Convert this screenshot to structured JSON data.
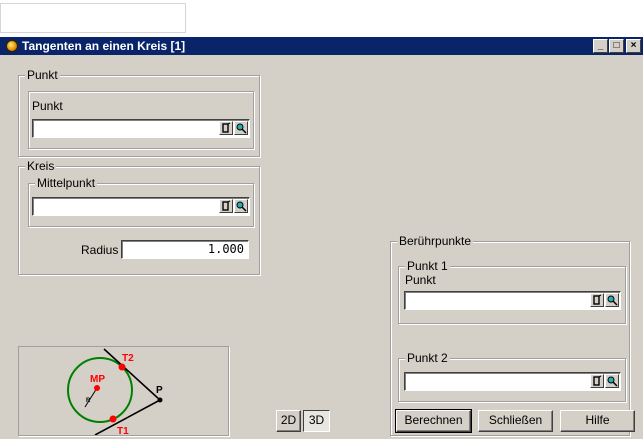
{
  "window": {
    "title": "Tangenten an einen Kreis [1]",
    "controls": {
      "minimize": "_",
      "maximize": "□",
      "close": "×"
    }
  },
  "punkt_group": {
    "label": "Punkt",
    "inner_label": "Punkt",
    "value": ""
  },
  "kreis_group": {
    "label": "Kreis",
    "mittelpunkt_label": "Mittelpunkt",
    "mittelpunkt_value": "",
    "radius_label": "Radius",
    "radius_value": "1.000"
  },
  "beruehrpunkte_group": {
    "label": "Berührpunkte",
    "punkt1": {
      "label": "Punkt 1",
      "inner_label": "Punkt",
      "value": ""
    },
    "punkt2": {
      "label": "Punkt 2",
      "value": ""
    }
  },
  "diagram": {
    "labels": {
      "t1": "T1",
      "t2": "T2",
      "mp": "MP",
      "p": "P",
      "r": "R"
    },
    "colors": {
      "circle": "#008000",
      "points": "#ff0000",
      "tangent": "#000000"
    }
  },
  "view_toggle": {
    "option_2d": "2D",
    "option_3d": "3D",
    "selected": "3D"
  },
  "buttons": {
    "calculate": "Berechnen",
    "close": "Schließen",
    "help": "Hilfe"
  },
  "icons": {
    "field_pick_a": "select-point-icon",
    "field_pick_b": "pick-from-model-icon"
  }
}
